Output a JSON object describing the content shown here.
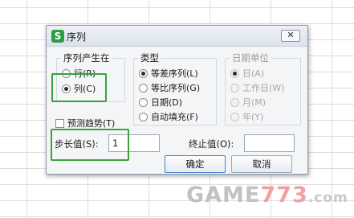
{
  "dialog": {
    "icon_text": "S",
    "title": "序列",
    "close_label": "✕"
  },
  "series_in": {
    "title": "序列产生在",
    "options": [
      {
        "label": "行(R)",
        "checked": false
      },
      {
        "label": "列(C)",
        "checked": true
      }
    ]
  },
  "type": {
    "title": "类型",
    "options": [
      {
        "label": "等差序列(L)",
        "checked": true
      },
      {
        "label": "等比序列(G)",
        "checked": false
      },
      {
        "label": "日期(D)",
        "checked": false
      },
      {
        "label": "自动填充(F)",
        "checked": false
      }
    ]
  },
  "date_unit": {
    "title": "日期单位",
    "disabled": true,
    "options": [
      {
        "label": "日(A)",
        "checked": true
      },
      {
        "label": "工作日(W)",
        "checked": false
      },
      {
        "label": "月(M)",
        "checked": false
      },
      {
        "label": "年(Y)",
        "checked": false
      }
    ]
  },
  "trend": {
    "label": "预测趋势(T)",
    "checked": false
  },
  "step": {
    "label": "步长值(S):",
    "value": "1"
  },
  "stop": {
    "label": "终止值(O):",
    "value": ""
  },
  "buttons": {
    "ok": "确定",
    "cancel": "取消"
  },
  "watermark": {
    "text": "GAME",
    "digits": "773",
    "domain": ".com"
  },
  "colors": {
    "highlight": "#3aa13a",
    "accent": "#3d7fd8"
  }
}
